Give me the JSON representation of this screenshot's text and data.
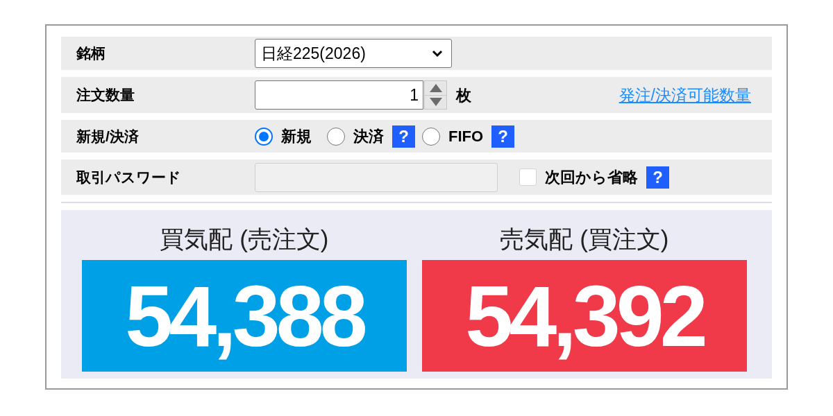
{
  "form": {
    "rows": [
      {
        "kind": "select",
        "label": "銘柄",
        "value": "日経225(2026)"
      },
      {
        "kind": "number",
        "label": "注文数量",
        "value": "1",
        "unit": "枚",
        "link": "発注/決済可能数量"
      },
      {
        "kind": "radio",
        "label": "新規/決済",
        "options": [
          {
            "label": "新規",
            "selected": true
          },
          {
            "label": "決済",
            "selected": false,
            "help": "?"
          },
          {
            "label": "FIFO",
            "selected": false,
            "help": "?"
          }
        ]
      },
      {
        "kind": "password",
        "label": "取引パスワード",
        "disabled": true,
        "remember": {
          "label": "次回から省略",
          "checked": false,
          "help": "?"
        }
      }
    ]
  },
  "quotes": [
    {
      "label": "買気配 (売注文)",
      "price": "54,388",
      "color": "#00a0e6"
    },
    {
      "label": "売気配 (買注文)",
      "price": "54,392",
      "color": "#f03a4a"
    }
  ]
}
